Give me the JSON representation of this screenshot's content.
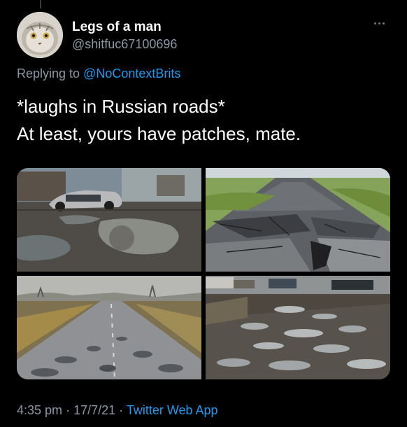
{
  "author": {
    "name": "Legs of a man",
    "handle": "@shitfuc67100696",
    "avatar_icon": "pallas-cat-avatar"
  },
  "reply": {
    "prefix": "Replying to",
    "mention": "@NoContextBrits"
  },
  "tweet": {
    "text": "*laughs in Russian roads*\nAt least, yours have patches, mate."
  },
  "media": {
    "images": [
      {
        "subject": "potholed-parking-lot-with-car"
      },
      {
        "subject": "cracked-broken-asphalt-road"
      },
      {
        "subject": "long-potholed-rural-road"
      },
      {
        "subject": "puddle-filled-potholes-street"
      }
    ]
  },
  "footer": {
    "time": "4:35 pm",
    "sep1": "·",
    "date": "17/7/21",
    "sep2": "·",
    "source": "Twitter Web App"
  },
  "colors": {
    "background": "#000000",
    "secondary_text": "#8b98a5",
    "link": "#1d9bf0"
  },
  "icons": {
    "more": "more-options-icon"
  }
}
